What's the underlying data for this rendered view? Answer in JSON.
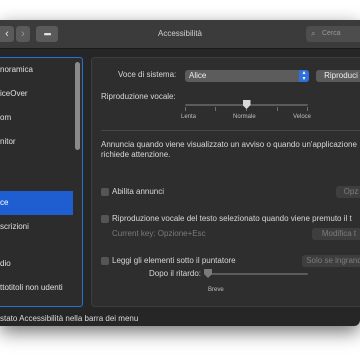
{
  "window": {
    "title": "Accessibilità"
  },
  "toolbar": {
    "back": "‹",
    "forward": "›",
    "grid": "▪▪▪",
    "search_placeholder": "Cerca",
    "search_icon": "magnifier-icon"
  },
  "sidebar": {
    "items": [
      {
        "label": "noramica"
      },
      {
        "label": "iceOver"
      },
      {
        "label": "om"
      },
      {
        "label": "nitor"
      },
      {
        "label": "ce",
        "selected": true
      },
      {
        "label": "scrizioni"
      },
      {
        "label": "dio"
      },
      {
        "label": "ttotitoli non udenti"
      }
    ]
  },
  "speech": {
    "voice_label": "Voce di sistema:",
    "voice_value": "Alice",
    "play_button": "Riproduci",
    "rate_label": "Riproduzione vocale:",
    "rate_slow": "Lenta",
    "rate_normal": "Normale",
    "rate_fast": "Veloce",
    "rate_value": 0.5,
    "announce_text_1": "Annuncia quando viene visualizzato un avviso o quando un'applicazione",
    "announce_text_2": "richiede attenzione.",
    "announce_checkbox": "Abilita annunci",
    "announce_options": "Opz",
    "selected_text_checkbox": "Riproduzione vocale del testo selezionato quando viene premuto il t",
    "current_key": "Current key: Opzione+Esc",
    "change_key_button": "Modifica t",
    "pointer_checkbox": "Leggi gli elementi sotto il puntatore",
    "pointer_dropdown": "Solo se ingrand",
    "delay_label": "Dopo il ritardo:",
    "delay_short": "Breve",
    "delay_value": 0.0
  },
  "footer": {
    "text": "stato Accessibilità nella barra dei menu"
  }
}
